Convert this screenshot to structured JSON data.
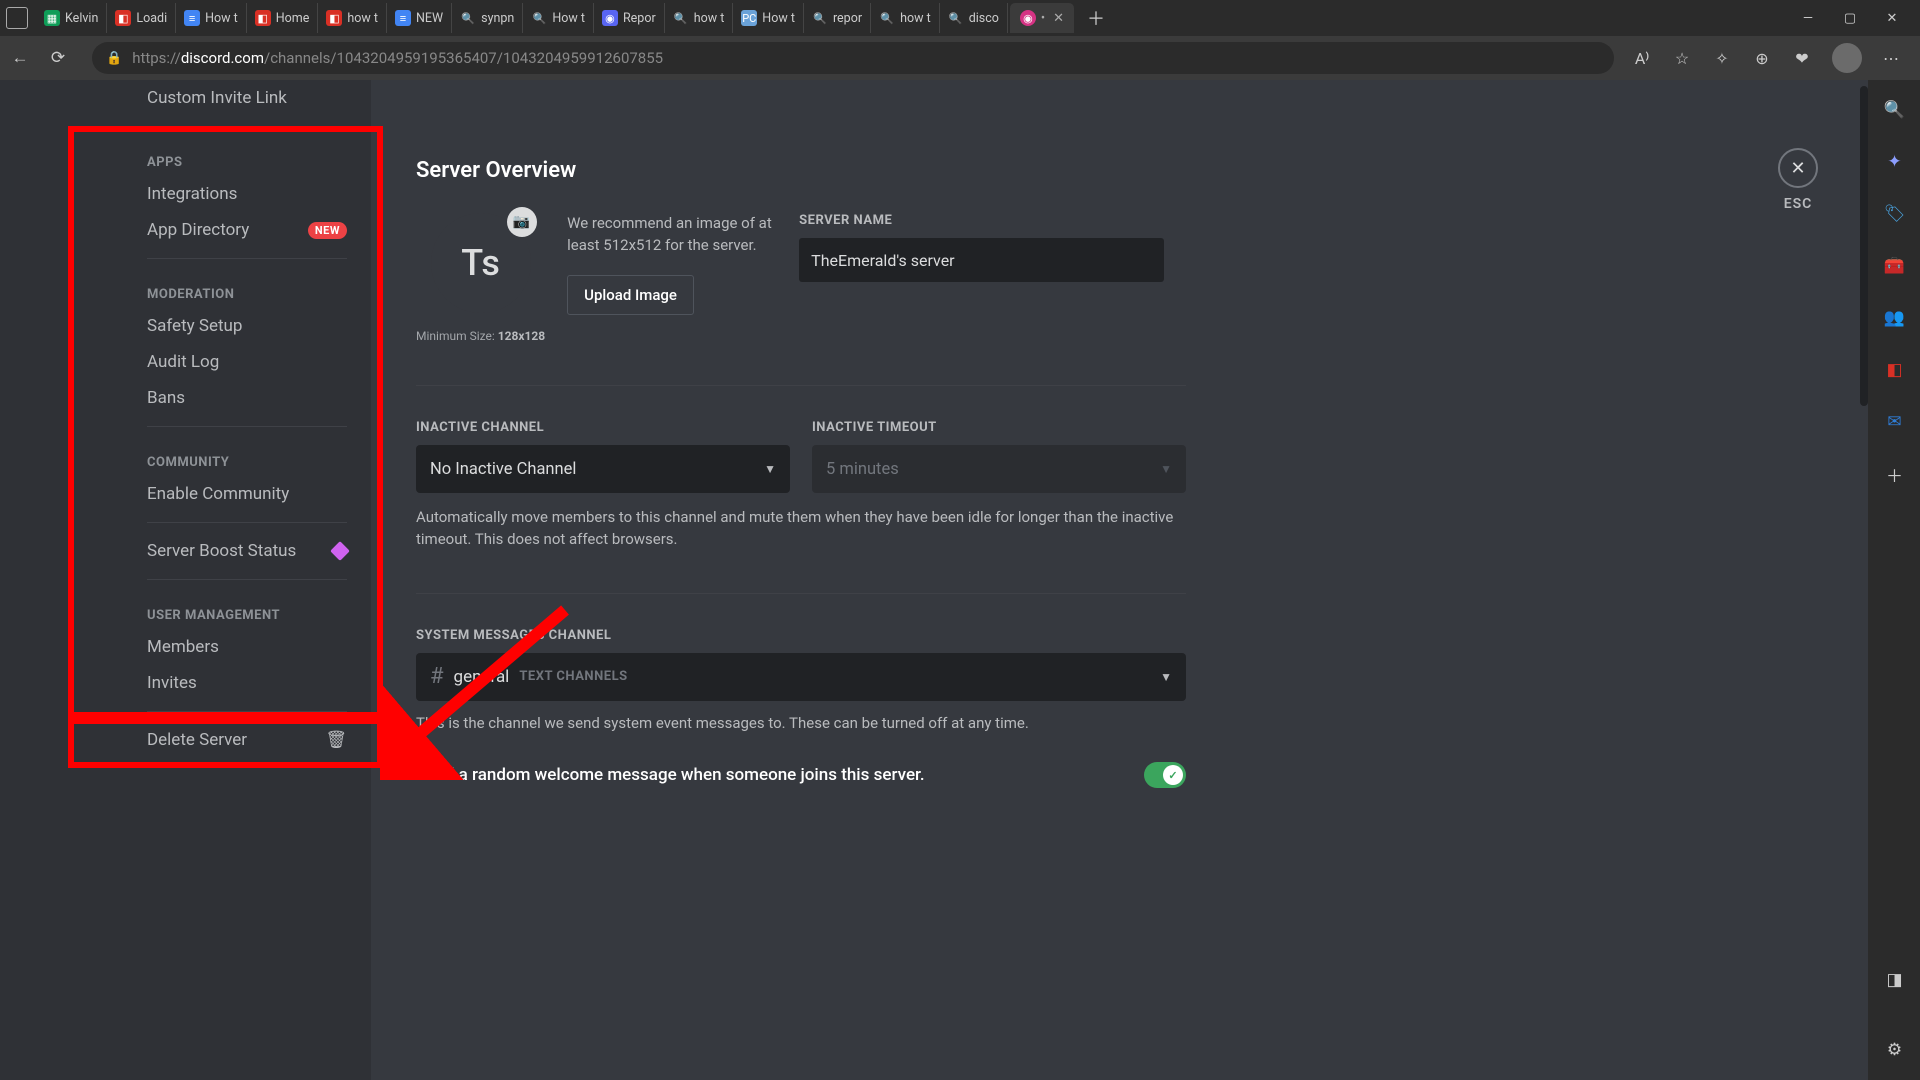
{
  "browser": {
    "tabs": [
      {
        "fav_bg": "#0f9d58",
        "fav_txt": "▦",
        "label": "Kelvin"
      },
      {
        "fav_bg": "#d93025",
        "fav_txt": "◧",
        "label": "Loadi"
      },
      {
        "fav_bg": "#4285f4",
        "fav_txt": "≡",
        "label": "How t"
      },
      {
        "fav_bg": "#d93025",
        "fav_txt": "◧",
        "label": "Home"
      },
      {
        "fav_bg": "#d93025",
        "fav_txt": "◧",
        "label": "how t"
      },
      {
        "fav_bg": "#4285f4",
        "fav_txt": "≡",
        "label": "NEW"
      },
      {
        "fav_bg": "transparent",
        "fav_txt": "🔍",
        "label": "synpn"
      },
      {
        "fav_bg": "transparent",
        "fav_txt": "🔍",
        "label": "How t"
      },
      {
        "fav_bg": "#5865f2",
        "fav_txt": "◉",
        "label": "Repor"
      },
      {
        "fav_bg": "transparent",
        "fav_txt": "🔍",
        "label": "how t"
      },
      {
        "fav_bg": "#6aa2d8",
        "fav_txt": "PC",
        "label": "How t"
      },
      {
        "fav_bg": "transparent",
        "fav_txt": "🔍",
        "label": "repor"
      },
      {
        "fav_bg": "transparent",
        "fav_txt": "🔍",
        "label": "how t"
      },
      {
        "fav_bg": "transparent",
        "fav_txt": "🔍",
        "label": "disco"
      }
    ],
    "active_tab_fav": "◎",
    "active_tab_dot": "•",
    "url_prefix": "https://",
    "url_host": "discord.com",
    "url_path": "/channels/1043204959195365407/1043204959912607855"
  },
  "sidebar": {
    "custom_invite": "Custom Invite Link",
    "sec_apps": "APPS",
    "integrations": "Integrations",
    "app_directory": "App Directory",
    "new_badge": "NEW",
    "sec_moderation": "MODERATION",
    "safety_setup": "Safety Setup",
    "audit_log": "Audit Log",
    "bans": "Bans",
    "sec_community": "COMMUNITY",
    "enable_community": "Enable Community",
    "server_boost": "Server Boost Status",
    "sec_user_mgmt": "USER MANAGEMENT",
    "members": "Members",
    "invites": "Invites",
    "delete_server": "Delete Server"
  },
  "main": {
    "title": "Server Overview",
    "esc": "ESC",
    "avatar_text": "Ts",
    "min_size_prefix": "Minimum Size: ",
    "min_size_value": "128x128",
    "recommend": "We recommend an image of at least 512x512 for the server.",
    "upload_btn": "Upload Image",
    "server_name_label": "SERVER NAME",
    "server_name_value": "TheEmerald's server",
    "inactive_channel_label": "INACTIVE CHANNEL",
    "inactive_channel_value": "No Inactive Channel",
    "inactive_timeout_label": "INACTIVE TIMEOUT",
    "inactive_timeout_value": "5 minutes",
    "inactive_helper": "Automatically move members to this channel and mute them when they have been idle for longer than the inactive timeout. This does not affect browsers.",
    "sys_label": "SYSTEM MESSAGES CHANNEL",
    "sys_channel": "general",
    "sys_category": "TEXT CHANNELS",
    "sys_helper": "This is the channel we send system event messages to. These can be turned off at any time.",
    "welcome_toggle": "Send a random welcome message when someone joins this server."
  },
  "rightbar": {
    "icons": [
      {
        "glyph": "🔍",
        "color": "#4aa3df"
      },
      {
        "glyph": "✦",
        "color": "#8c9eff"
      },
      {
        "glyph": "🏷",
        "color": "#4aa3df"
      },
      {
        "glyph": "🧰",
        "color": "#f0a020"
      },
      {
        "glyph": "👥",
        "color": "#f0a020"
      },
      {
        "glyph": "◧",
        "color": "#d93025"
      },
      {
        "glyph": "✉",
        "color": "#2f7ed8"
      },
      {
        "glyph": "＋",
        "color": "#ccc"
      }
    ]
  }
}
